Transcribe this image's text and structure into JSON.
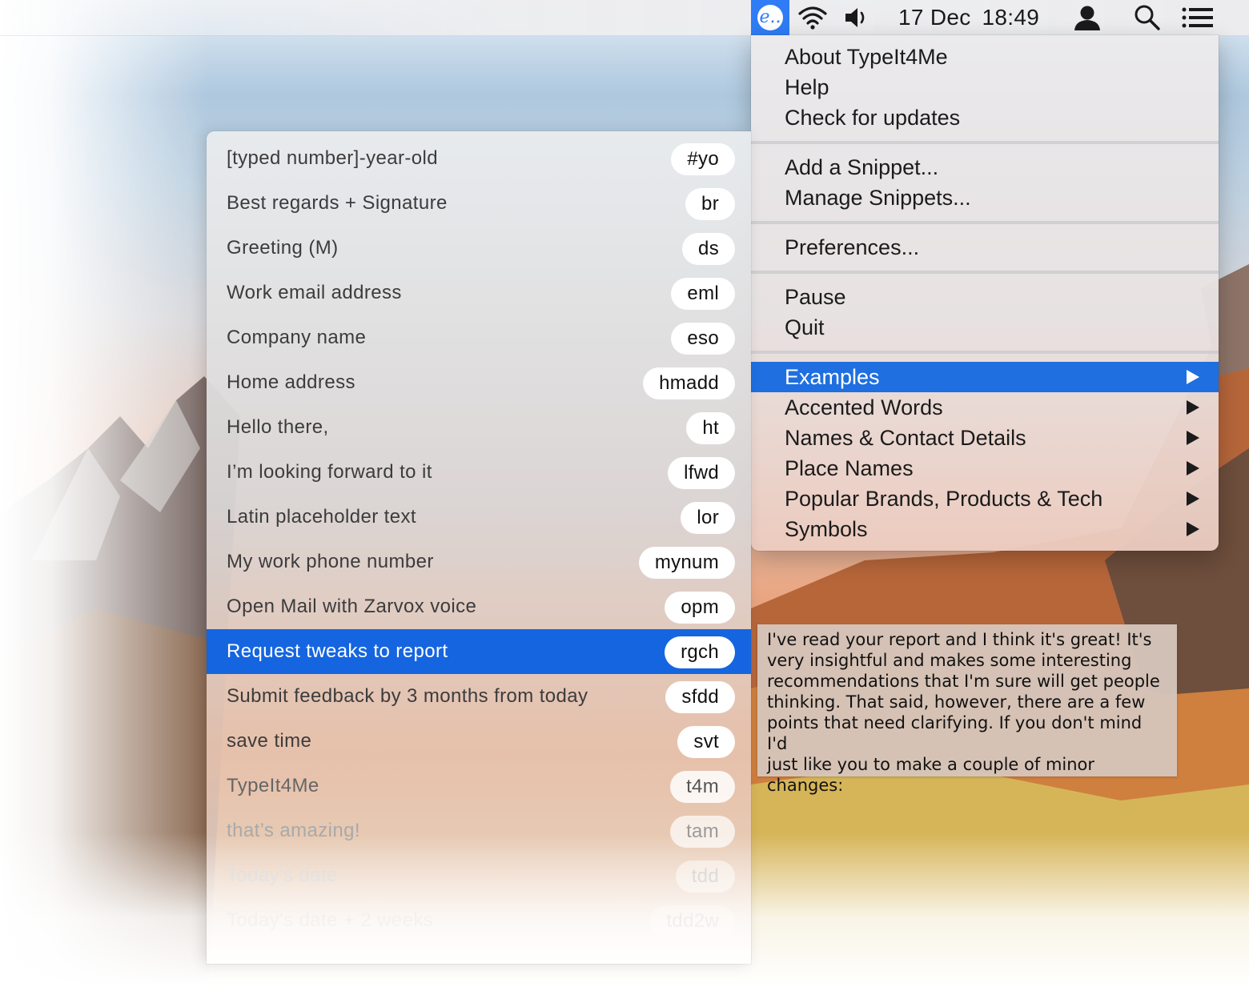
{
  "menubar": {
    "app_icon_glyph": "e..",
    "date": "17 Dec",
    "time": "18:49",
    "icons": [
      "typeit4me-icon",
      "wifi-icon",
      "volume-icon",
      "user-icon",
      "spotlight-search-icon",
      "notification-center-icon"
    ]
  },
  "main_menu": {
    "items": [
      {
        "label": "About TypeIt4Me"
      },
      {
        "label": "Help"
      },
      {
        "label": "Check for updates"
      },
      {
        "label": "Add a Snippet..."
      },
      {
        "label": "Manage Snippets..."
      },
      {
        "label": "Preferences..."
      },
      {
        "label": "Pause"
      },
      {
        "label": "Quit"
      },
      {
        "label": "Examples",
        "submenu": true,
        "selected": true
      },
      {
        "label": "Accented Words",
        "submenu": true
      },
      {
        "label": "Names & Contact Details",
        "submenu": true
      },
      {
        "label": "Place Names",
        "submenu": true
      },
      {
        "label": "Popular Brands, Products & Tech",
        "submenu": true
      },
      {
        "label": "Symbols",
        "submenu": true
      }
    ]
  },
  "snippets": [
    {
      "label": "[typed number]-year-old",
      "abbr": "#yo"
    },
    {
      "label": "Best regards + Signature",
      "abbr": "br"
    },
    {
      "label": "Greeting (M)",
      "abbr": "ds"
    },
    {
      "label": "Work email address",
      "abbr": "eml"
    },
    {
      "label": "Company name",
      "abbr": "eso"
    },
    {
      "label": "Home address",
      "abbr": "hmadd"
    },
    {
      "label": "Hello there,",
      "abbr": "ht"
    },
    {
      "label": "I’m looking forward to it",
      "abbr": "lfwd"
    },
    {
      "label": "Latin placeholder text",
      "abbr": "lor"
    },
    {
      "label": "My work phone number",
      "abbr": "mynum"
    },
    {
      "label": "Open Mail with Zarvox voice",
      "abbr": "opm"
    },
    {
      "label": "Request tweaks to report",
      "abbr": "rgch",
      "selected": true
    },
    {
      "label": "Submit feedback by 3 months from today",
      "abbr": "sfdd"
    },
    {
      "label": "save time",
      "abbr": "svt"
    },
    {
      "label": "TypeIt4Me",
      "abbr": "t4m"
    },
    {
      "label": "that’s amazing!",
      "abbr": "tam"
    },
    {
      "label": "Today's date",
      "abbr": "tdd"
    },
    {
      "label": "Today's date + 2 weeks",
      "abbr": "tdd2w"
    }
  ],
  "preview": {
    "lines": [
      "I've read your report and I think it's great! It's",
      "very insightful and makes some interesting",
      "recommendations that I'm sure will get people",
      "thinking. That said, however, there are a few",
      "points that need clarifying. If you don't mind I'd",
      "just like you to make a couple of minor",
      "changes:"
    ]
  },
  "colors": {
    "selection": "#1f6fe0",
    "app_icon_bg": "#2f7cf6"
  }
}
